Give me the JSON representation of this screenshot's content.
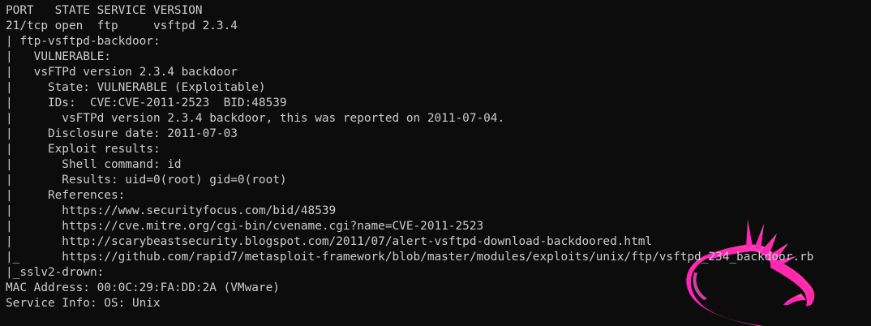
{
  "terminal": {
    "lines": [
      "PORT   STATE SERVICE VERSION",
      "21/tcp open  ftp     vsftpd 2.3.4",
      "| ftp-vsftpd-backdoor:",
      "|   VULNERABLE:",
      "|   vsFTPd version 2.3.4 backdoor",
      "|     State: VULNERABLE (Exploitable)",
      "|     IDs:  CVE:CVE-2011-2523  BID:48539",
      "|       vsFTPd version 2.3.4 backdoor, this was reported on 2011-07-04.",
      "|     Disclosure date: 2011-07-03",
      "|     Exploit results:",
      "|       Shell command: id",
      "|       Results: uid=0(root) gid=0(root)",
      "|     References:",
      "|       https://www.securityfocus.com/bid/48539",
      "|       https://cve.mitre.org/cgi-bin/cvename.cgi?name=CVE-2011-2523",
      "|       http://scarybeastsecurity.blogspot.com/2011/07/alert-vsftpd-download-backdoored.html",
      "|_      https://github.com/rapid7/metasploit-framework/blob/master/modules/exploits/unix/ftp/vsftpd_234_backdoor.rb",
      "|_sslv2-drown:",
      "MAC Address: 00:0C:29:FA:DD:2A (VMware)",
      "Service Info: OS: Unix"
    ]
  },
  "colors": {
    "background": "#0c0c0c",
    "text": "#cccccc",
    "logo_gradient_start": "#ff1ecf",
    "logo_gradient_end": "#ff6ab0"
  },
  "icons": {
    "background_logo": "kali-dragon-icon"
  }
}
